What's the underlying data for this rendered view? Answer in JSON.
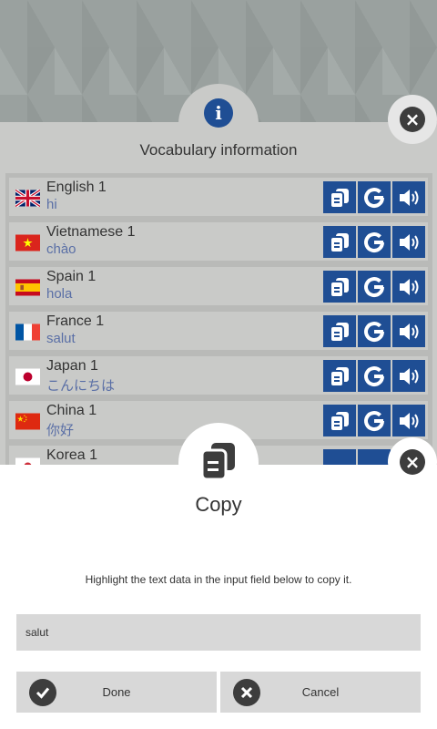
{
  "vocab_dialog": {
    "title": "Vocabulary information",
    "items": [
      {
        "language": "English 1",
        "word": "hi",
        "flag": "uk-flag-icon"
      },
      {
        "language": "Vietnamese 1",
        "word": "chào",
        "flag": "vietnam-flag-icon"
      },
      {
        "language": "Spain 1",
        "word": "hola",
        "flag": "spain-flag-icon"
      },
      {
        "language": "France 1",
        "word": "salut",
        "flag": "france-flag-icon"
      },
      {
        "language": "Japan 1",
        "word": "こんにちは",
        "flag": "japan-flag-icon"
      },
      {
        "language": "China 1",
        "word": "你好",
        "flag": "china-flag-icon"
      },
      {
        "language": "Korea 1",
        "word": "",
        "flag": "korea-flag-icon"
      }
    ],
    "action_icons": [
      "copy-icon",
      "google-translate-icon",
      "speaker-icon"
    ],
    "accent_color": "#1f4e94"
  },
  "copy_dialog": {
    "title": "Copy",
    "hint": "Highlight the text data in the input field below to copy it.",
    "input_value": "salut",
    "done_label": "Done",
    "cancel_label": "Cancel"
  }
}
